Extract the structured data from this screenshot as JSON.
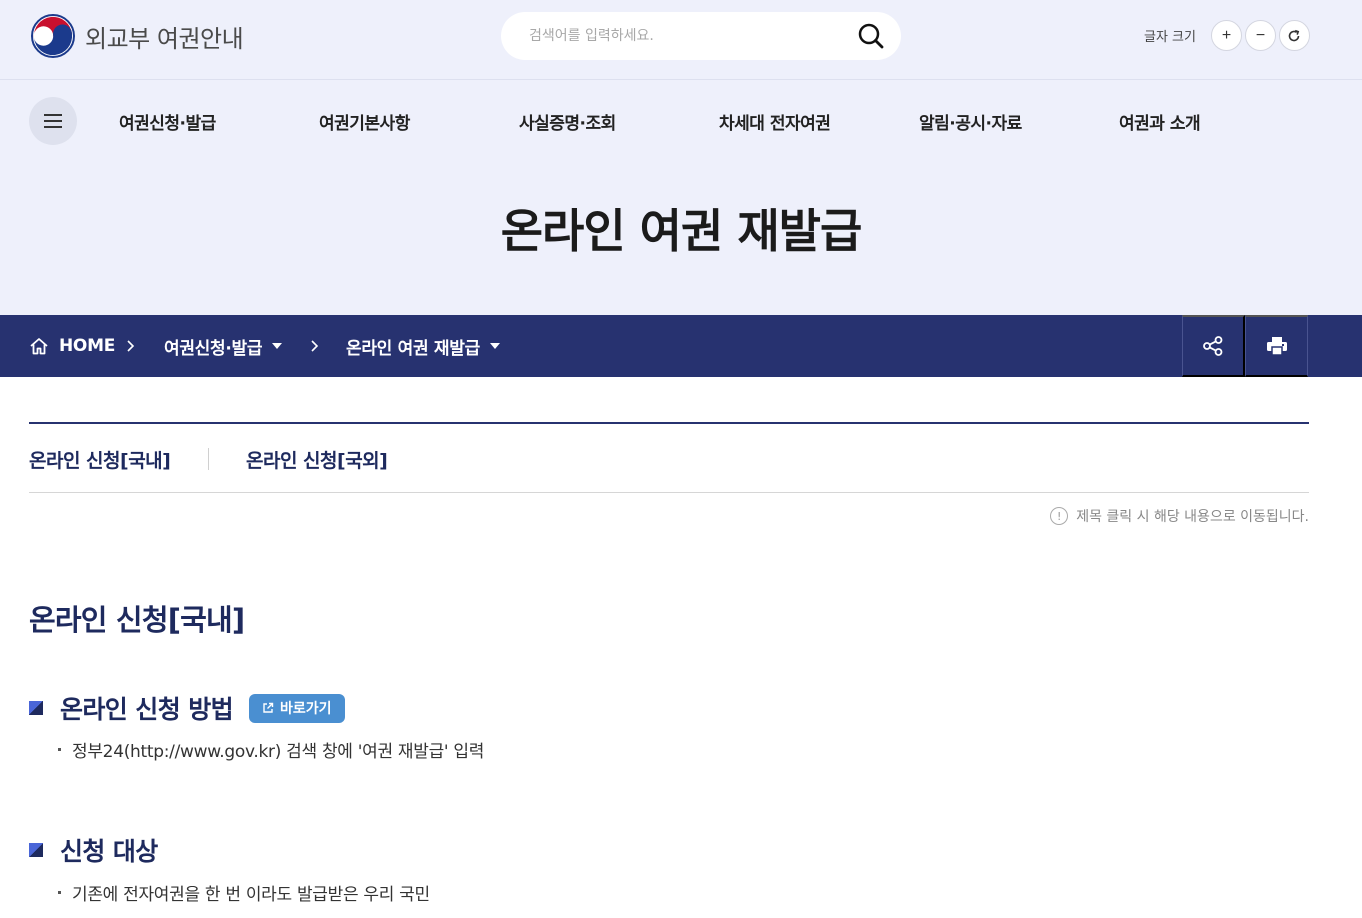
{
  "header": {
    "site_title": "외교부 여권안내",
    "search_placeholder": "검색어를 입력하세요.",
    "font_size_label": "글자 크기",
    "font_plus": "+",
    "font_minus": "−"
  },
  "gnb": {
    "items": [
      {
        "label": "여권신청·발급"
      },
      {
        "label": "여권기본사항"
      },
      {
        "label": "사실증명·조회"
      },
      {
        "label": "차세대 전자여권"
      },
      {
        "label": "알림·공시·자료"
      },
      {
        "label": "여권과 소개"
      }
    ]
  },
  "page": {
    "title": "온라인 여권 재발급"
  },
  "location": {
    "home": "HOME",
    "depth1": "여권신청·발급",
    "depth2": "온라인 여권 재발급"
  },
  "tabs": {
    "items": [
      {
        "label": "온라인 신청[국내]"
      },
      {
        "label": "온라인 신청[국외]"
      }
    ],
    "notice": "제목 클릭 시 해당 내용으로 이동됩니다.",
    "notice_icon_glyph": "!"
  },
  "content": {
    "section_title": "온라인 신청[국내]",
    "blocks": [
      {
        "heading": "온라인 신청 방법",
        "button": "바로가기",
        "items": [
          "정부24(http://www.gov.kr) 검색 창에 '여권 재발급' 입력"
        ]
      },
      {
        "heading": "신청 대상",
        "items": [
          "기존에 전자여권을 한 번 이라도 발급받은 우리 국민"
        ]
      }
    ]
  },
  "colors": {
    "navy": "#273270",
    "header_bg": "#eef0fb",
    "button_blue": "#4a8fd1"
  }
}
